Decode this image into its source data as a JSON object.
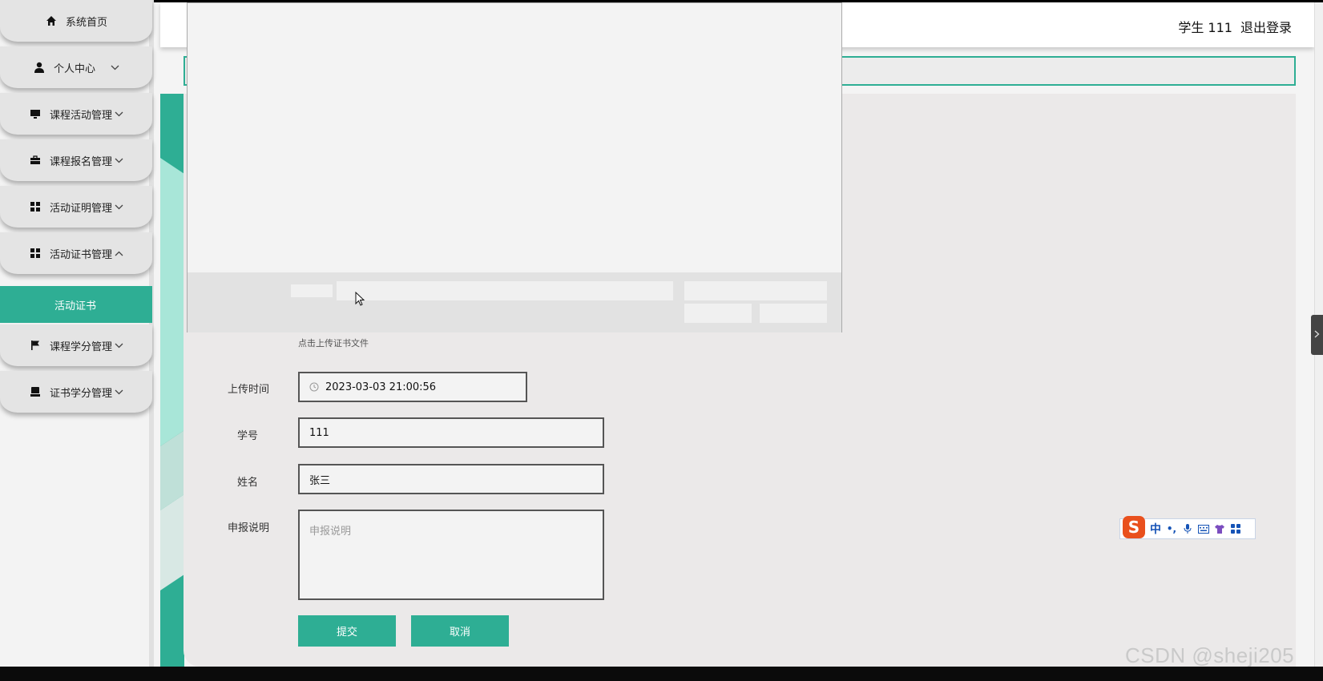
{
  "sidebar": {
    "items": [
      {
        "label": "系统首页",
        "icon": "home-icon",
        "chevron": ""
      },
      {
        "label": "个人中心",
        "icon": "user-icon",
        "chevron": "down"
      },
      {
        "label": "课程活动管理",
        "icon": "monitor-icon",
        "chevron": "down"
      },
      {
        "label": "课程报名管理",
        "icon": "briefcase-icon",
        "chevron": "down"
      },
      {
        "label": "活动证明管理",
        "icon": "grid-icon",
        "chevron": "down"
      },
      {
        "label": "活动证书管理",
        "icon": "grid-icon",
        "chevron": "up"
      },
      {
        "label": "课程学分管理",
        "icon": "flag-icon",
        "chevron": "down"
      },
      {
        "label": "证书学分管理",
        "icon": "stamp-icon",
        "chevron": "down"
      }
    ],
    "active_sub": "活动证书"
  },
  "header": {
    "user": "学生 111",
    "logout": "退出登录"
  },
  "form": {
    "upload_hint": "点击上传证书文件",
    "upload_time_label": "上传时间",
    "upload_time_value": "2023-03-03 21:00:56",
    "student_id_label": "学号",
    "student_id_value": "111",
    "name_label": "姓名",
    "name_value": "张三",
    "description_label": "申报说明",
    "description_placeholder": "申报说明",
    "submit_label": "提交",
    "cancel_label": "取消"
  },
  "ime": {
    "logo": "S",
    "mode": "中",
    "punct": "•,"
  },
  "watermark": "CSDN @sheji205",
  "colors": {
    "accent": "#2eae94",
    "sidebar_item": "#e4e4e4",
    "panel": "#ebe9e9"
  }
}
